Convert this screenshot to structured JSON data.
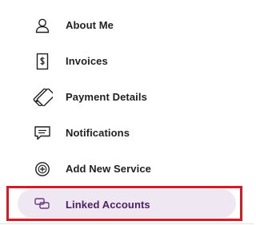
{
  "menu": {
    "items": [
      {
        "label": "About Me",
        "icon": "person-icon"
      },
      {
        "label": "Invoices",
        "icon": "invoice-icon"
      },
      {
        "label": "Payment Details",
        "icon": "payment-card-icon"
      },
      {
        "label": "Notifications",
        "icon": "chat-bubble-icon"
      },
      {
        "label": "Add New Service",
        "icon": "add-circle-icon"
      },
      {
        "label": "Linked Accounts",
        "icon": "linked-accounts-icon",
        "selected": true
      }
    ]
  },
  "colors": {
    "text": "#1f1f1f",
    "selected_text": "#4a2162",
    "selected_background": "#efe8f3",
    "highlight_border": "#d71a28",
    "icon_stroke": "#1f1f1f",
    "selected_icon_stroke": "#6a3a86"
  }
}
